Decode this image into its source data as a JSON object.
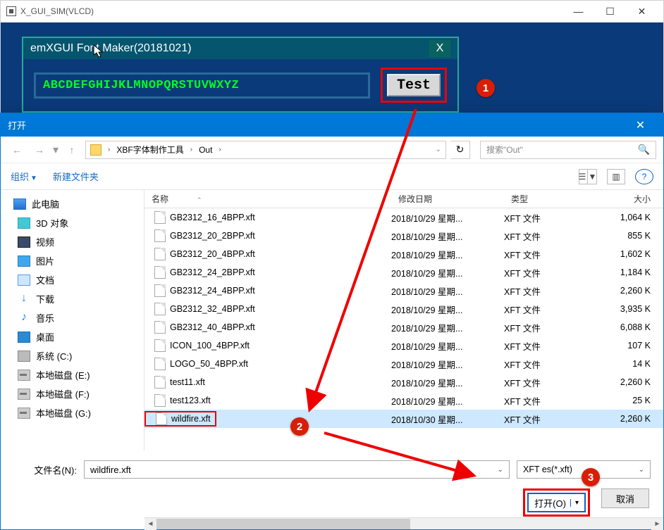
{
  "outer_window": {
    "title": "X_GUI_SIM(VLCD)",
    "minimize": "—",
    "maximize": "☐",
    "close": "✕"
  },
  "emx": {
    "title": "emXGUI Font Maker(20181021)",
    "close": "X",
    "preview": "ABCDEFGHIJKLMNOPQRSTUVWXYZ",
    "test_btn": "Test"
  },
  "dialog": {
    "title": "打开",
    "close": "✕",
    "nav_back": "←",
    "nav_fwd": "→",
    "nav_up": "↑",
    "breadcrumb": {
      "seg1": "XBF字体制作工具",
      "seg2": "Out",
      "sep": "›"
    },
    "refresh": "↻",
    "search_placeholder": "搜索\"Out\"",
    "toolbar": {
      "organize": "组织",
      "newfolder": "新建文件夹"
    },
    "columns": {
      "name": "名称",
      "date": "修改日期",
      "type": "类型",
      "size": "大小"
    },
    "sidebar": [
      {
        "label": "此电脑",
        "icon": "i-pc",
        "root": true
      },
      {
        "label": "3D 对象",
        "icon": "i-3d"
      },
      {
        "label": "视频",
        "icon": "i-video"
      },
      {
        "label": "图片",
        "icon": "i-pic"
      },
      {
        "label": "文档",
        "icon": "i-doc"
      },
      {
        "label": "下载",
        "icon": "i-dl",
        "glyph": "↓"
      },
      {
        "label": "音乐",
        "icon": "i-music",
        "glyph": "♪"
      },
      {
        "label": "桌面",
        "icon": "i-desk"
      },
      {
        "label": "系统 (C:)",
        "icon": "i-sys"
      },
      {
        "label": "本地磁盘 (E:)",
        "icon": "i-drive"
      },
      {
        "label": "本地磁盘 (F:)",
        "icon": "i-drive"
      },
      {
        "label": "本地磁盘 (G:)",
        "icon": "i-drive"
      }
    ],
    "files": [
      {
        "name": "GB2312_16_4BPP.xft",
        "date": "2018/10/29 星期...",
        "type": "XFT 文件",
        "size": "1,064 K"
      },
      {
        "name": "GB2312_20_2BPP.xft",
        "date": "2018/10/29 星期...",
        "type": "XFT 文件",
        "size": "855 K"
      },
      {
        "name": "GB2312_20_4BPP.xft",
        "date": "2018/10/29 星期...",
        "type": "XFT 文件",
        "size": "1,602 K"
      },
      {
        "name": "GB2312_24_2BPP.xft",
        "date": "2018/10/29 星期...",
        "type": "XFT 文件",
        "size": "1,184 K"
      },
      {
        "name": "GB2312_24_4BPP.xft",
        "date": "2018/10/29 星期...",
        "type": "XFT 文件",
        "size": "2,260 K"
      },
      {
        "name": "GB2312_32_4BPP.xft",
        "date": "2018/10/29 星期...",
        "type": "XFT 文件",
        "size": "3,935 K"
      },
      {
        "name": "GB2312_40_4BPP.xft",
        "date": "2018/10/29 星期...",
        "type": "XFT 文件",
        "size": "6,088 K"
      },
      {
        "name": "ICON_100_4BPP.xft",
        "date": "2018/10/29 星期...",
        "type": "XFT 文件",
        "size": "107 K"
      },
      {
        "name": "LOGO_50_4BPP.xft",
        "date": "2018/10/29 星期...",
        "type": "XFT 文件",
        "size": "14 K"
      },
      {
        "name": "test11.xft",
        "date": "2018/10/29 星期...",
        "type": "XFT 文件",
        "size": "2,260 K"
      },
      {
        "name": "test123.xft",
        "date": "2018/10/29 星期...",
        "type": "XFT 文件",
        "size": "25 K"
      },
      {
        "name": "wildfire.xft",
        "date": "2018/10/30 星期...",
        "type": "XFT 文件",
        "size": "2,260 K",
        "selected": true
      }
    ],
    "footer": {
      "filename_label": "文件名(N):",
      "filename_value": "wildfire.xft",
      "filetype_value": "XFT   es(*.xft)",
      "open_btn": "打开(O)",
      "cancel_btn": "取消",
      "dropdown_caret": "▾"
    }
  },
  "callouts": {
    "c1": "1",
    "c2": "2",
    "c3": "3"
  }
}
